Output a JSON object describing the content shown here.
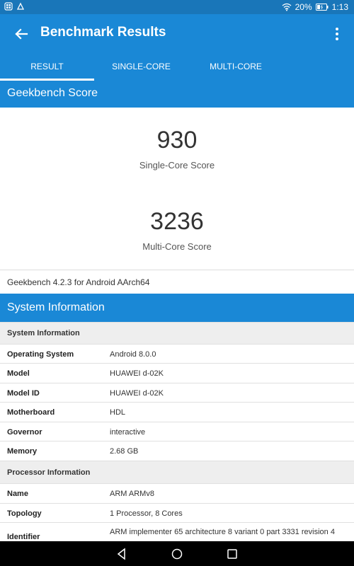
{
  "status_bar": {
    "battery": "20%",
    "time": "1:13"
  },
  "app_bar": {
    "title": "Benchmark Results"
  },
  "tabs": [
    {
      "label": "RESULT",
      "active": true
    },
    {
      "label": "SINGLE-CORE",
      "active": false
    },
    {
      "label": "MULTI-CORE",
      "active": false
    }
  ],
  "geekbench": {
    "header": "Geekbench Score",
    "single_core_score": "930",
    "single_core_label": "Single-Core Score",
    "multi_core_score": "3236",
    "multi_core_label": "Multi-Core Score",
    "version": "Geekbench 4.2.3 for Android AArch64"
  },
  "system_information": {
    "header": "System Information",
    "groups": [
      {
        "title": "System Information",
        "rows": [
          {
            "key": "Operating System",
            "value": "Android 8.0.0"
          },
          {
            "key": "Model",
            "value": "HUAWEI d-02K"
          },
          {
            "key": "Model ID",
            "value": "HUAWEI d-02K"
          },
          {
            "key": "Motherboard",
            "value": "HDL"
          },
          {
            "key": "Governor",
            "value": "interactive"
          },
          {
            "key": "Memory",
            "value": "2.68 GB"
          }
        ]
      },
      {
        "title": "Processor Information",
        "rows": [
          {
            "key": "Name",
            "value": "ARM ARMv8"
          },
          {
            "key": "Topology",
            "value": "1 Processor, 8 Cores"
          },
          {
            "key": "Identifier",
            "value": "ARM implementer 65 architecture 8 variant 0 part 3331 revision 4"
          }
        ]
      }
    ]
  },
  "colors": {
    "primary": "#1a88d6",
    "status_bar": "#1976b9",
    "nav_bar": "#000000"
  },
  "icons": {
    "back": "arrow-back-icon",
    "menu": "more-vert-icon",
    "nav_back": "nav-back-icon",
    "nav_home": "nav-home-icon",
    "nav_recents": "nav-recents-icon"
  }
}
